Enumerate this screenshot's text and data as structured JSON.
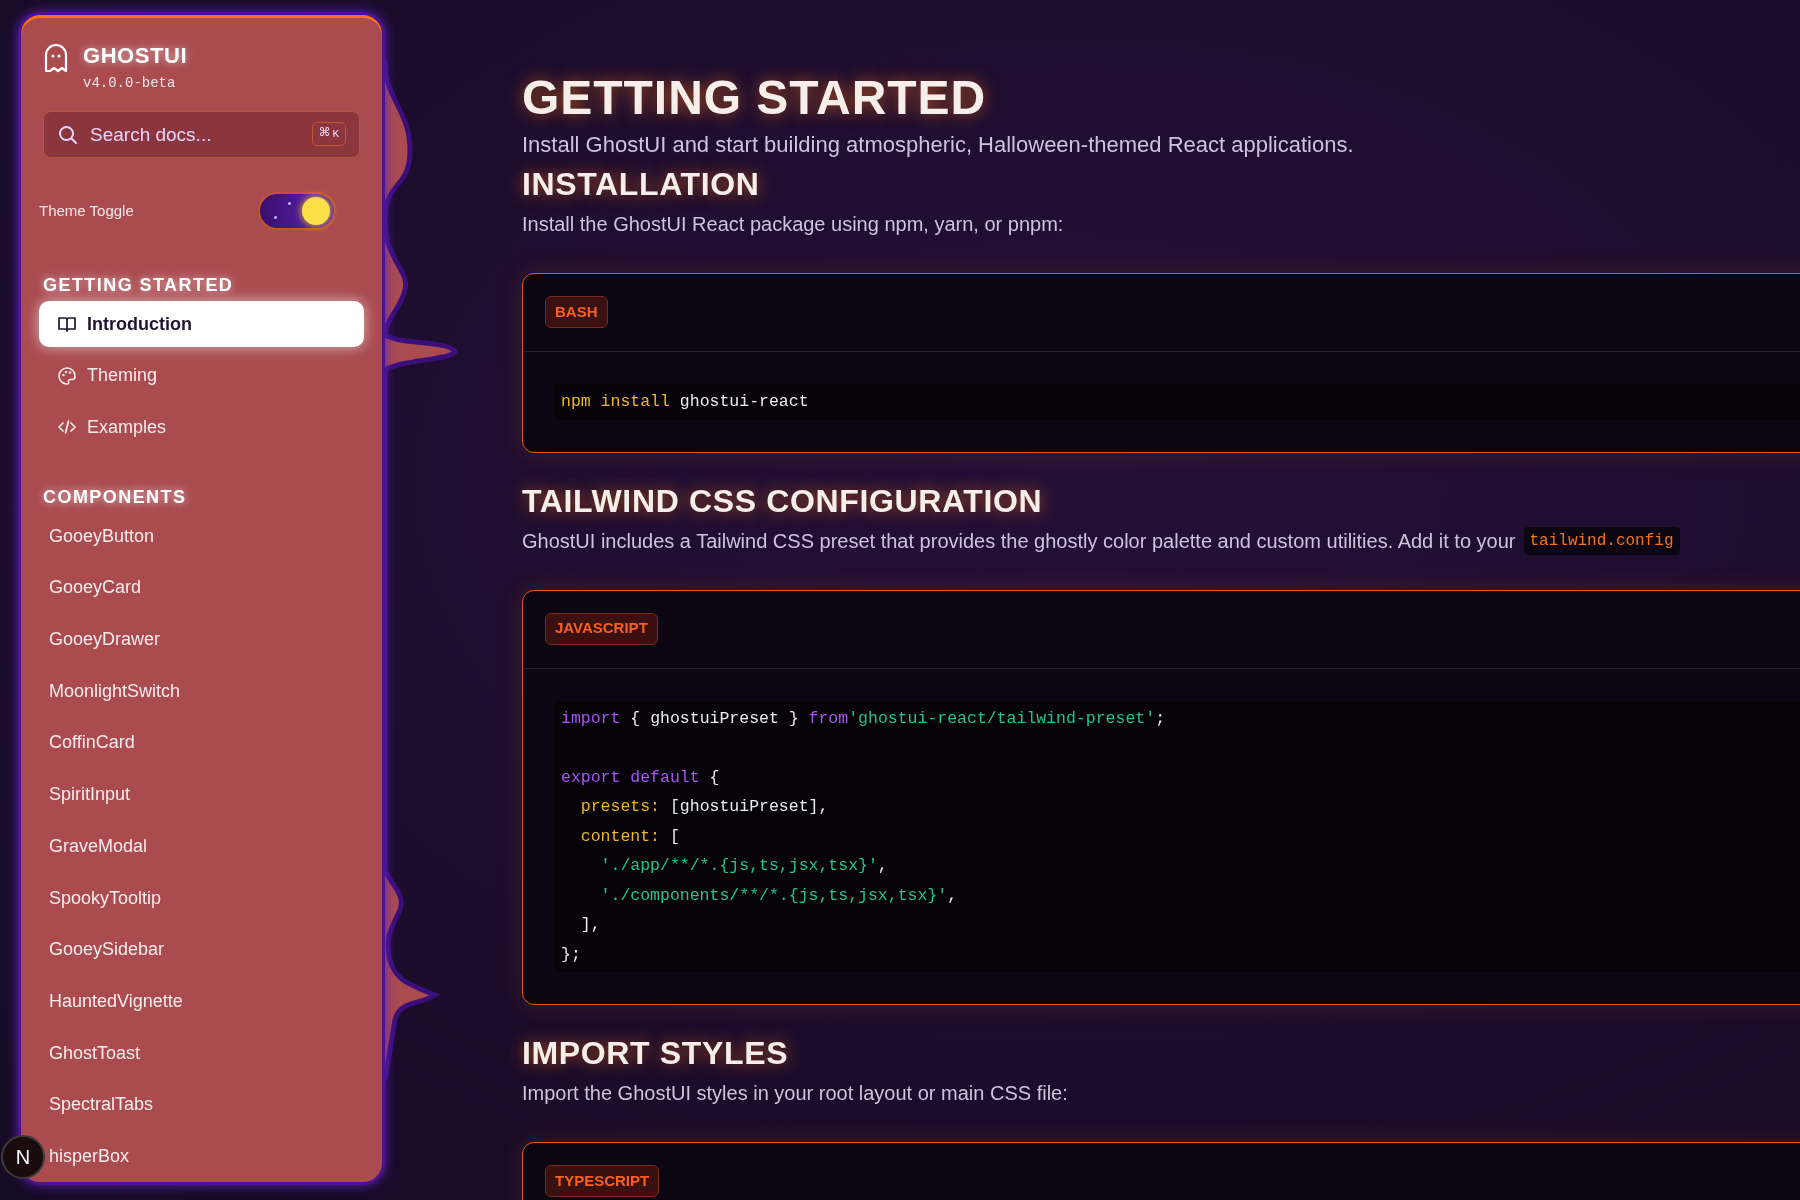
{
  "sidebar": {
    "brand": "GHOSTUI",
    "version": "v4.0.0-beta",
    "search": {
      "placeholder": "Search docs...",
      "shortcut_symbol": "⌘",
      "shortcut_key": "K"
    },
    "theme_toggle": {
      "label": "Theme Toggle",
      "on": true
    },
    "sections": [
      {
        "title": "GETTING STARTED",
        "items": [
          {
            "label": "Introduction",
            "selected": true
          },
          {
            "label": "Theming",
            "selected": false
          },
          {
            "label": "Examples",
            "selected": false
          }
        ]
      },
      {
        "title": "COMPONENTS",
        "items": [
          {
            "label": "GooeyButton",
            "selected": false
          },
          {
            "label": "GooeyCard",
            "selected": false
          },
          {
            "label": "GooeyDrawer",
            "selected": false
          },
          {
            "label": "MoonlightSwitch",
            "selected": false
          },
          {
            "label": "CoffinCard",
            "selected": false
          },
          {
            "label": "SpiritInput",
            "selected": false
          },
          {
            "label": "GraveModal",
            "selected": false
          },
          {
            "label": "SpookyTooltip",
            "selected": false
          },
          {
            "label": "GooeySidebar",
            "selected": false
          },
          {
            "label": "HauntedVignette",
            "selected": false
          },
          {
            "label": "GhostToast",
            "selected": false
          },
          {
            "label": "SpectralTabs",
            "selected": false
          },
          {
            "label": "hisperBox",
            "selected": false
          }
        ]
      }
    ],
    "dev_badge": "N"
  },
  "page": {
    "title": "GETTING STARTED",
    "subtitle": "Install GhostUI and start building atmospheric, Halloween-themed React applications.",
    "sections": [
      {
        "heading": "INSTALLATION",
        "text": "Install the GhostUI React package using npm, yarn, or pnpm:",
        "code": {
          "language": "BASH",
          "lines": [
            {
              "tokens": [
                {
                  "t": "npm install",
                  "kind": "command"
                },
                {
                  "t": " ghostui-react",
                  "kind": "plain"
                }
              ]
            }
          ]
        }
      },
      {
        "heading": "TAILWIND CSS CONFIGURATION",
        "text": "GhostUI includes a Tailwind CSS preset that provides the ghostly color palette and custom utilities. Add it to your",
        "inline_code": "tailwind.config",
        "code": {
          "language": "JAVASCRIPT",
          "lines": [
            {
              "tokens": [
                {
                  "t": "import",
                  "kind": "keyword"
                },
                {
                  "t": " { ghostuiPreset } ",
                  "kind": "plain"
                },
                {
                  "t": "from",
                  "kind": "keyword"
                },
                {
                  "t": "'ghostui-react/tailwind-preset'",
                  "kind": "string"
                },
                {
                  "t": ";",
                  "kind": "plain"
                }
              ],
              "blank_after": true
            },
            {
              "tokens": [
                {
                  "t": "export default",
                  "kind": "keyword"
                },
                {
                  "t": " {",
                  "kind": "plain"
                }
              ]
            },
            {
              "tokens": [
                {
                  "t": "  presets:",
                  "kind": "property"
                },
                {
                  "t": " [ghostuiPreset],",
                  "kind": "plain"
                }
              ]
            },
            {
              "tokens": [
                {
                  "t": "  content:",
                  "kind": "property"
                },
                {
                  "t": " [",
                  "kind": "plain"
                }
              ]
            },
            {
              "tokens": [
                {
                  "t": "    './app/**/*.{js,ts,jsx,tsx}'",
                  "kind": "string"
                },
                {
                  "t": ",",
                  "kind": "plain"
                }
              ]
            },
            {
              "tokens": [
                {
                  "t": "    './components/**/*.{js,ts,jsx,tsx}'",
                  "kind": "string"
                },
                {
                  "t": ",",
                  "kind": "plain"
                }
              ]
            },
            {
              "tokens": [
                {
                  "t": "  ],",
                  "kind": "plain"
                }
              ]
            },
            {
              "tokens": [
                {
                  "t": "};",
                  "kind": "plain"
                }
              ]
            }
          ]
        }
      },
      {
        "heading": "IMPORT STYLES",
        "text": "Import the GhostUI styles in your root layout or main CSS file:",
        "code": {
          "language": "TYPESCRIPT"
        }
      }
    ]
  }
}
